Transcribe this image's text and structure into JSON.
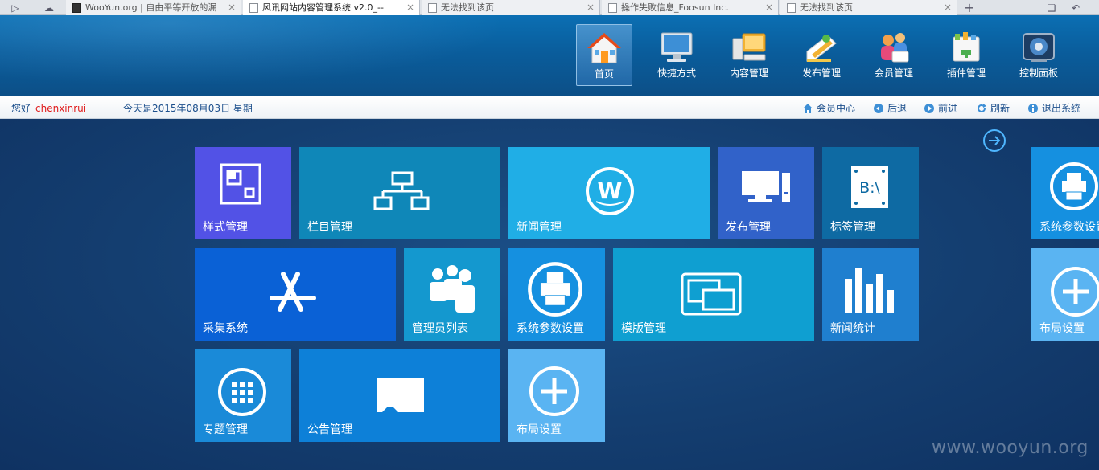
{
  "browser": {
    "tabs": [
      {
        "title": "WooYun.org | 自由平等开放的漏",
        "favicon": "dark"
      },
      {
        "title": "风讯网站内容管理系统 v2.0_--",
        "favicon": "doc",
        "active": true
      },
      {
        "title": "无法找到该页",
        "favicon": "doc"
      },
      {
        "title": "操作失败信息_Foosun Inc.",
        "favicon": "doc"
      },
      {
        "title": "无法找到该页",
        "favicon": "doc"
      }
    ],
    "new_tab": "+"
  },
  "header": {
    "nav": [
      {
        "label": "首页",
        "icon": "home-icon",
        "active": true
      },
      {
        "label": "快捷方式",
        "icon": "monitor-icon"
      },
      {
        "label": "内容管理",
        "icon": "computer-icon"
      },
      {
        "label": "发布管理",
        "icon": "pencil-icon"
      },
      {
        "label": "会员管理",
        "icon": "users-icon"
      },
      {
        "label": "插件管理",
        "icon": "plugin-icon"
      },
      {
        "label": "控制面板",
        "icon": "control-panel-icon"
      }
    ]
  },
  "statusbar": {
    "greeting": "您好",
    "username": "chenxinrui",
    "today": "今天是2015年08月03日 星期一",
    "links": [
      {
        "label": "会员中心",
        "icon": "home-small-icon"
      },
      {
        "label": "后退",
        "icon": "back-icon"
      },
      {
        "label": "前进",
        "icon": "forward-icon"
      },
      {
        "label": "刷新",
        "icon": "refresh-icon"
      },
      {
        "label": "退出系统",
        "icon": "info-icon"
      }
    ]
  },
  "tiles": [
    {
      "label": "样式管理",
      "icon": "style-icon",
      "color": "#5252e6"
    },
    {
      "label": "栏目管理",
      "icon": "sitemap-icon",
      "color": "#0f87b8"
    },
    {
      "label": "新闻管理",
      "icon": "news-w-icon",
      "color": "#20aee6"
    },
    {
      "label": "发布管理",
      "icon": "desktop-icon",
      "color": "#3162c9"
    },
    {
      "label": "标签管理",
      "icon": "tag-bat-icon",
      "color": "#0e6aa3"
    },
    {
      "label": "系统参数设置",
      "icon": "printer-icon",
      "color": "#1590e0"
    },
    {
      "label": "采集系统",
      "icon": "appstore-icon",
      "color": "#0a61d6"
    },
    {
      "label": "管理员列表",
      "icon": "admins-icon",
      "color": "#1498cf"
    },
    {
      "label": "系统参数设置",
      "icon": "printer-icon",
      "color": "#1590e0"
    },
    {
      "label": "模版管理",
      "icon": "template-icon",
      "color": "#0f9fd1"
    },
    {
      "label": "新闻统计",
      "icon": "bar-chart-icon",
      "color": "#1f7fcf"
    },
    {
      "label": "布局设置",
      "icon": "plus-circle-icon",
      "color": "#5ab4f2"
    },
    {
      "label": "专题管理",
      "icon": "grid-circle-icon",
      "color": "#1a8ad8"
    },
    {
      "label": "公告管理",
      "icon": "sdcard-icon",
      "color": "#0d80d8"
    },
    {
      "label": "布局设置",
      "icon": "plus-circle-icon",
      "color": "#5ab4f2"
    }
  ],
  "watermark": "www.wooyun.org"
}
